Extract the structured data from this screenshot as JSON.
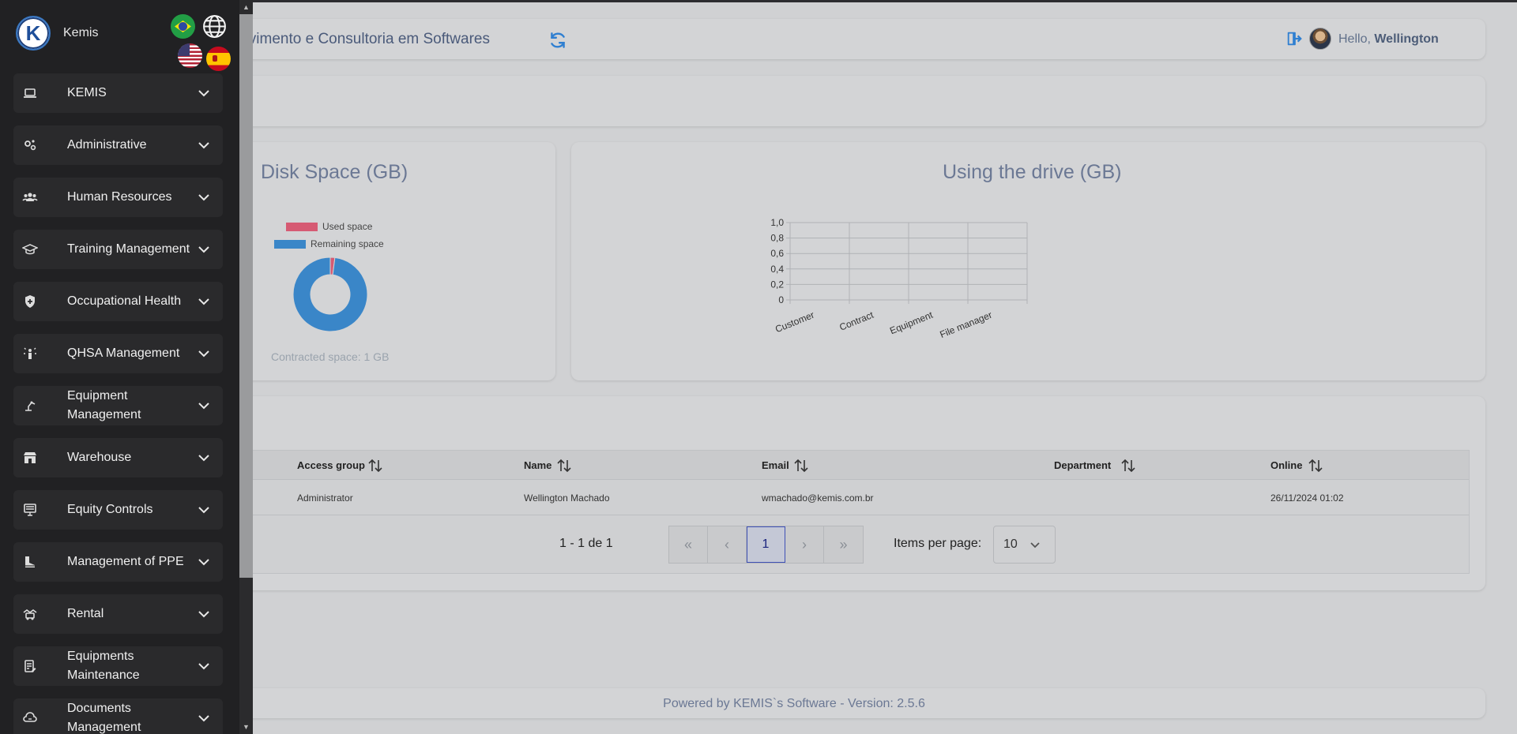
{
  "app": {
    "brand": "Kemis",
    "logo_letter": "K",
    "company_title": "olvimento e Consultoria em Softwares",
    "greeting_prefix": "Hello, ",
    "user_name": "Wellington",
    "footer": "Powered by KEMIS`s Software - Version: 2.5.6"
  },
  "colors": {
    "sidebar_bg": "#212123",
    "menu_item_bg": "#2a2a2c",
    "used_space": "#d65a73",
    "remaining_space": "#3a86c8",
    "accent": "#3f51b5",
    "refresh": "#2f7fd1"
  },
  "sidebar": {
    "items": [
      {
        "label": "KEMIS",
        "icon": "laptop-icon"
      },
      {
        "label": "Administrative",
        "icon": "gears-icon"
      },
      {
        "label": "Human Resources",
        "icon": "users-icon"
      },
      {
        "label": "Training Management",
        "icon": "graduation-cap-icon"
      },
      {
        "label": "Occupational Health",
        "icon": "shield-plus-icon"
      },
      {
        "label": "QHSA Management",
        "icon": "person-sparkle-icon"
      },
      {
        "label": "Equipment Management",
        "icon": "robot-arm-icon"
      },
      {
        "label": "Warehouse",
        "icon": "store-icon"
      },
      {
        "label": "Equity Controls",
        "icon": "desktop-icon"
      },
      {
        "label": "Management of PPE",
        "icon": "boot-icon"
      },
      {
        "label": "Rental",
        "icon": "handshake-icon"
      },
      {
        "label": "Equipments Maintenance",
        "icon": "clipboard-edit-icon"
      },
      {
        "label": "Documents Management",
        "icon": "cloud-doc-icon"
      }
    ]
  },
  "disk_card": {
    "title": "Disk Space (GB)",
    "contracted": "Contracted space: 1 GB"
  },
  "drive_card": {
    "title": "Using the drive (GB)"
  },
  "chart_data": [
    {
      "type": "pie",
      "title": "Disk Space (GB)",
      "labels": [
        "Used space",
        "Remaining space"
      ],
      "values": [
        0.02,
        0.98
      ],
      "legend": "top"
    },
    {
      "type": "bar",
      "title": "Using the drive (GB)",
      "categories": [
        "Customer",
        "Contract",
        "Equipment",
        "File manager"
      ],
      "values": [
        0,
        0,
        0,
        0
      ],
      "ylim": [
        0,
        1
      ],
      "yticks": [
        "1,0",
        "0,8",
        "0,6",
        "0,4",
        "0,2",
        "0"
      ],
      "grid": true
    }
  ],
  "table": {
    "headers": [
      "Access group",
      "Name",
      "Email",
      "Department",
      "Online"
    ],
    "rows": [
      [
        "Administrator",
        "Wellington Machado",
        "wmachado@kemis.com.br",
        "",
        "26/11/2024 01:02"
      ]
    ]
  },
  "pagination": {
    "range": "1 - 1 de 1",
    "first": "«",
    "prev": "‹",
    "current": "1",
    "next": "›",
    "last": "»",
    "items_per_page_label": "Items per page:",
    "items_per_page_value": "10"
  }
}
